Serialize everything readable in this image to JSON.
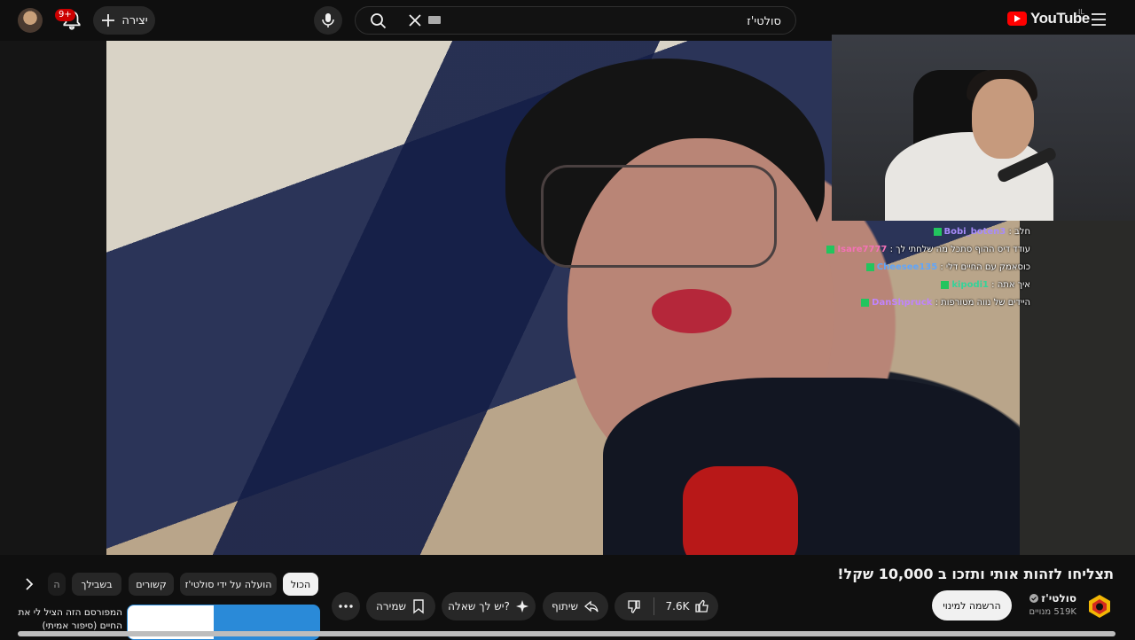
{
  "topbar": {
    "notifications_badge": "9+",
    "create_label": "יצירה",
    "search_value": "סולטי'ז",
    "logo_text": "YouTube",
    "logo_country": "IL"
  },
  "chat": [
    {
      "user": "Bobi_boten3",
      "message": "חלב",
      "color": "#a78bfa"
    },
    {
      "user": "Isare7777",
      "message": "עודד דיס ההוף סתכל מה שלחתי לך",
      "color": "#f472b6"
    },
    {
      "user": "Cheesee135",
      "message": "כוסאמק עם החיים דלי",
      "color": "#60a5fa"
    },
    {
      "user": "kipodi1",
      "message": "איך אתה",
      "color": "#34d399"
    },
    {
      "user": "DanShpruck",
      "message": "היידים של נווה מטורפות",
      "color": "#c084fc"
    }
  ],
  "video": {
    "title": "תצליחו לזהות אותי ותזכו ב 10,000 שקל!",
    "channel_name": "סולטי'ז",
    "subscribers": "519K מנויים",
    "subscribe_label": "הרשמה למינוי",
    "likes": "7.6K",
    "share_label": "שיתוף",
    "ask_label": "יש לך שאלה?",
    "save_label": "שמירה"
  },
  "chips": [
    "הכול",
    "הועלה על ידי סולטי'ז",
    "קשורים",
    "בשבילך",
    "ה"
  ],
  "related": {
    "title": "המפורסם הזה הציל לי את החיים (סיפור אמיתי)"
  }
}
